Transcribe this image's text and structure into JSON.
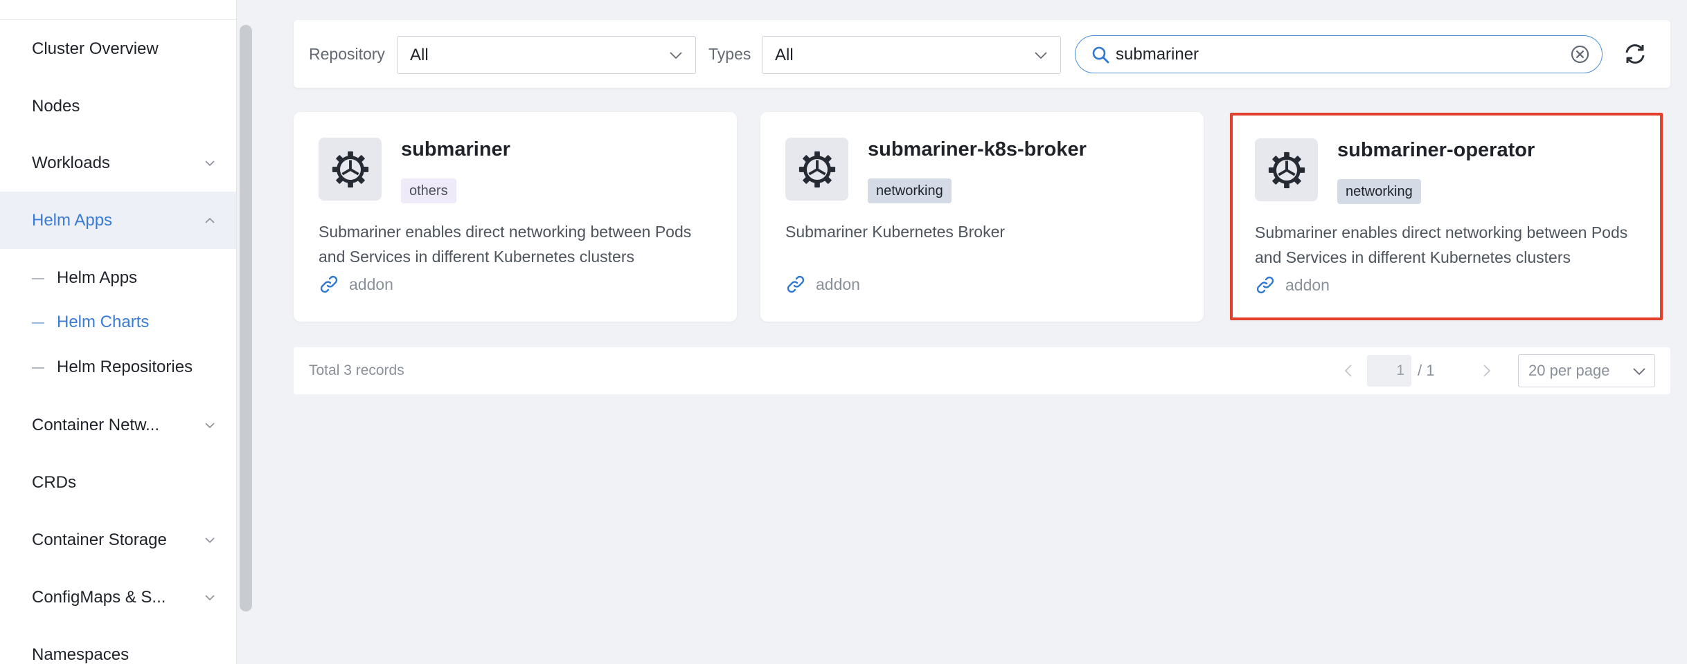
{
  "sidebar": {
    "items": [
      {
        "label": "Cluster Overview"
      },
      {
        "label": "Nodes"
      },
      {
        "label": "Workloads"
      },
      {
        "label": "Helm Apps"
      },
      {
        "label": "Container Netw..."
      },
      {
        "label": "CRDs"
      },
      {
        "label": "Container Storage"
      },
      {
        "label": "ConfigMaps & S..."
      },
      {
        "label": "Namespaces"
      }
    ],
    "sub_items": [
      {
        "label": "Helm Apps"
      },
      {
        "label": "Helm Charts"
      },
      {
        "label": "Helm Repositories"
      }
    ],
    "active_item": "Helm Apps",
    "active_sub_item": "Helm Charts"
  },
  "toolbar": {
    "repository_label": "Repository",
    "repository_value": "All",
    "types_label": "Types",
    "types_value": "All",
    "search_value": "submariner",
    "icons": [
      "search-icon",
      "clear-icon",
      "refresh-icon",
      "chevron-down-icon"
    ]
  },
  "cards": [
    {
      "title": "submariner",
      "tag": "others",
      "description": "Submariner enables direct networking between Pods and Services in different Kubernetes clusters",
      "link": "addon",
      "highlighted": false
    },
    {
      "title": "submariner-k8s-broker",
      "tag": "networking",
      "description": "Submariner Kubernetes Broker",
      "link": "addon",
      "highlighted": false
    },
    {
      "title": "submariner-operator",
      "tag": "networking",
      "description": "Submariner enables direct networking between Pods and Services in different Kubernetes clusters",
      "link": "addon",
      "highlighted": true
    }
  ],
  "pagination": {
    "total": "Total 3 records",
    "current_page": "1",
    "total_pages": "/ 1",
    "per_page": "20 per page"
  },
  "colors": {
    "accent": "#3a7bd5",
    "highlight_border": "#e2402b",
    "background": "#f1f2f5"
  }
}
